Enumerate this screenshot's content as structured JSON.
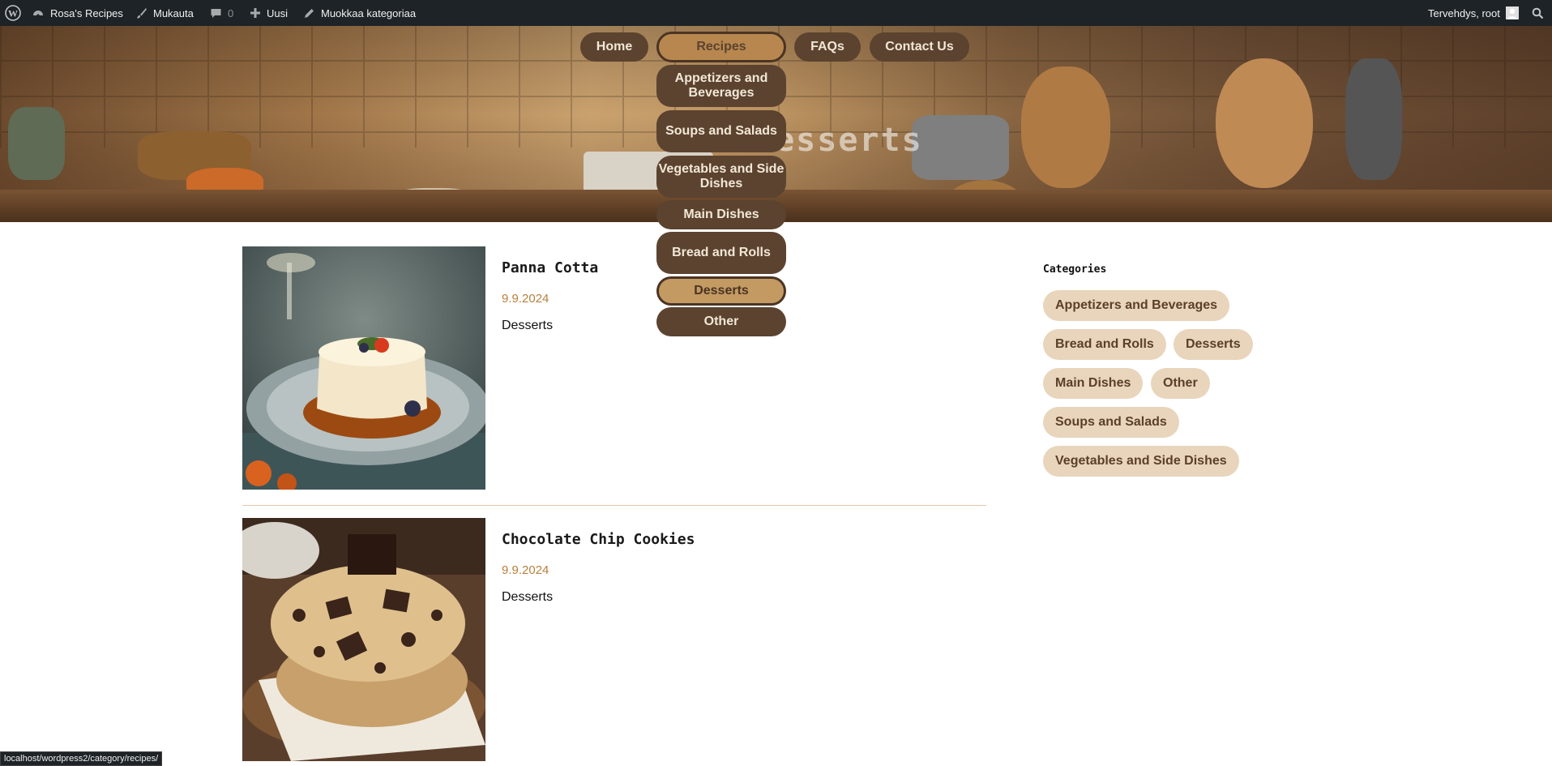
{
  "adminbar": {
    "wp_logo_icon": "wordpress-logo-icon",
    "site_name": "Rosa's Recipes",
    "customize": "Mukauta",
    "comments_count": "0",
    "new": "Uusi",
    "edit_category": "Muokkaa kategoriaa",
    "greeting": "Tervehdys, root"
  },
  "hero": {
    "title": "Desserts"
  },
  "nav": {
    "home": "Home",
    "recipes": "Recipes",
    "faqs": "FAQs",
    "contact": "Contact Us",
    "submenu": [
      "Appetizers and Beverages",
      "Soups and Salads",
      "Vegetables and Side Dishes",
      "Main Dishes",
      "Bread and Rolls",
      "Desserts",
      "Other"
    ]
  },
  "posts": [
    {
      "title": "Panna Cotta",
      "date": "9.9.2024",
      "category": "Desserts"
    },
    {
      "title": "Chocolate Chip Cookies",
      "date": "9.9.2024",
      "category": "Desserts"
    }
  ],
  "sidebar": {
    "heading": "Categories",
    "tags": [
      "Appetizers and Beverages",
      "Bread and Rolls",
      "Desserts",
      "Main Dishes",
      "Other",
      "Soups and Salads",
      "Vegetables and Side Dishes"
    ]
  },
  "status_url": "localhost/wordpress2/category/recipes/",
  "colors": {
    "pill_dark": "#5b4330",
    "pill_active": "#b8874f",
    "tag_bg": "#e8d5bc",
    "date": "#b97f3c"
  }
}
